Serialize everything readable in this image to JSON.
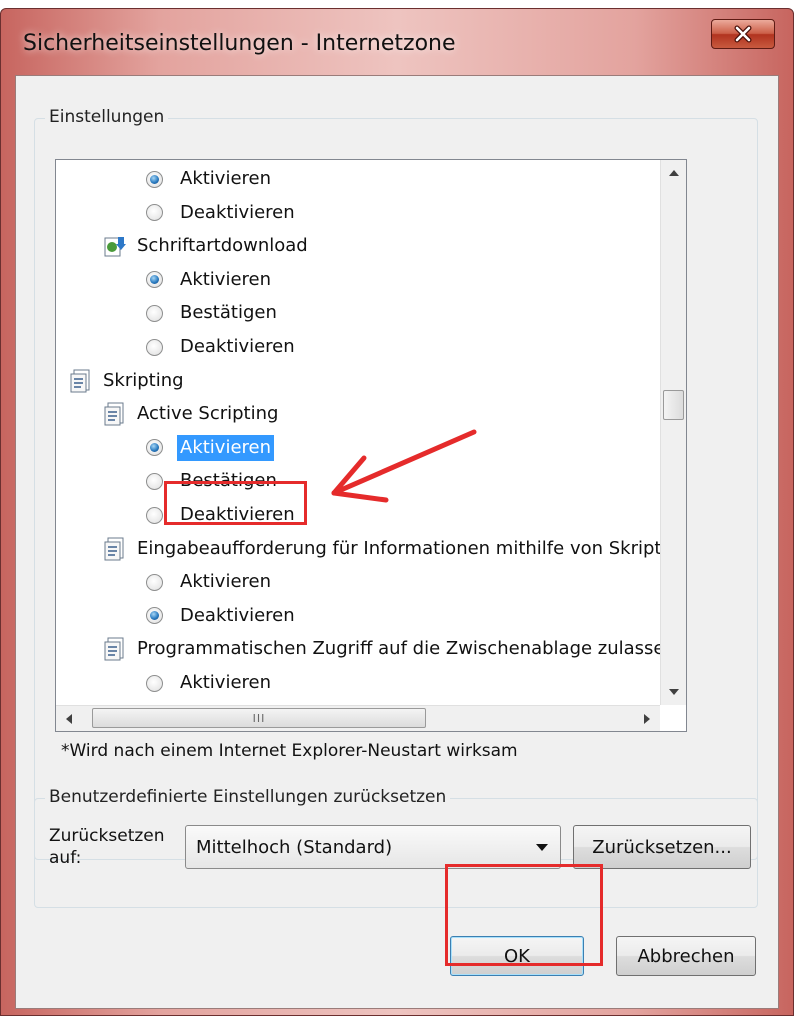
{
  "window": {
    "title": "Sicherheitseinstellungen - Internetzone",
    "close_icon": "x-icon",
    "titlebar_color": "#c7655f"
  },
  "settings": {
    "group_label": "Einstellungen",
    "tree": {
      "rows": [
        {
          "type": "radio",
          "label": "Aktivieren",
          "checked": true
        },
        {
          "type": "radio",
          "label": "Deaktivieren",
          "checked": false
        },
        {
          "type": "category",
          "label": "Schriftartdownload",
          "icon": "font-download-icon"
        },
        {
          "type": "radio",
          "label": "Aktivieren",
          "checked": true
        },
        {
          "type": "radio",
          "label": "Bestätigen",
          "checked": false
        },
        {
          "type": "radio",
          "label": "Deaktivieren",
          "checked": false
        },
        {
          "type": "category",
          "label": "Skripting",
          "icon": "script-icon"
        },
        {
          "type": "category",
          "label": "Active Scripting",
          "icon": "script-icon"
        },
        {
          "type": "radio",
          "label": "Aktivieren",
          "checked": true,
          "selected": true
        },
        {
          "type": "radio",
          "label": "Bestätigen",
          "checked": false
        },
        {
          "type": "radio",
          "label": "Deaktivieren",
          "checked": false
        },
        {
          "type": "category",
          "label": "Eingabeaufforderung für Informationen mithilfe von Skriptfer",
          "icon": "script-icon"
        },
        {
          "type": "radio",
          "label": "Aktivieren",
          "checked": false
        },
        {
          "type": "radio",
          "label": "Deaktivieren",
          "checked": true
        },
        {
          "type": "category",
          "label": "Programmatischen Zugriff auf die Zwischenablage zulassen",
          "icon": "script-icon"
        },
        {
          "type": "radio",
          "label": "Aktivieren",
          "checked": false
        }
      ]
    },
    "hscroll_grip": "III",
    "footnote": "*Wird nach einem Internet Explorer-Neustart wirksam"
  },
  "reset": {
    "group_label": "Benutzerdefinierte Einstellungen zurücksetzen",
    "reset_to_label": "Zurücksetzen auf:",
    "level_value": "Mittelhoch (Standard)",
    "reset_button": "Zurücksetzen..."
  },
  "buttons": {
    "ok": "OK",
    "cancel": "Abbrechen"
  },
  "annotations": {
    "highlight_color": "#e52b2b",
    "selection_color": "#3399ff",
    "radio_dot_color": "#2c7dc2"
  }
}
